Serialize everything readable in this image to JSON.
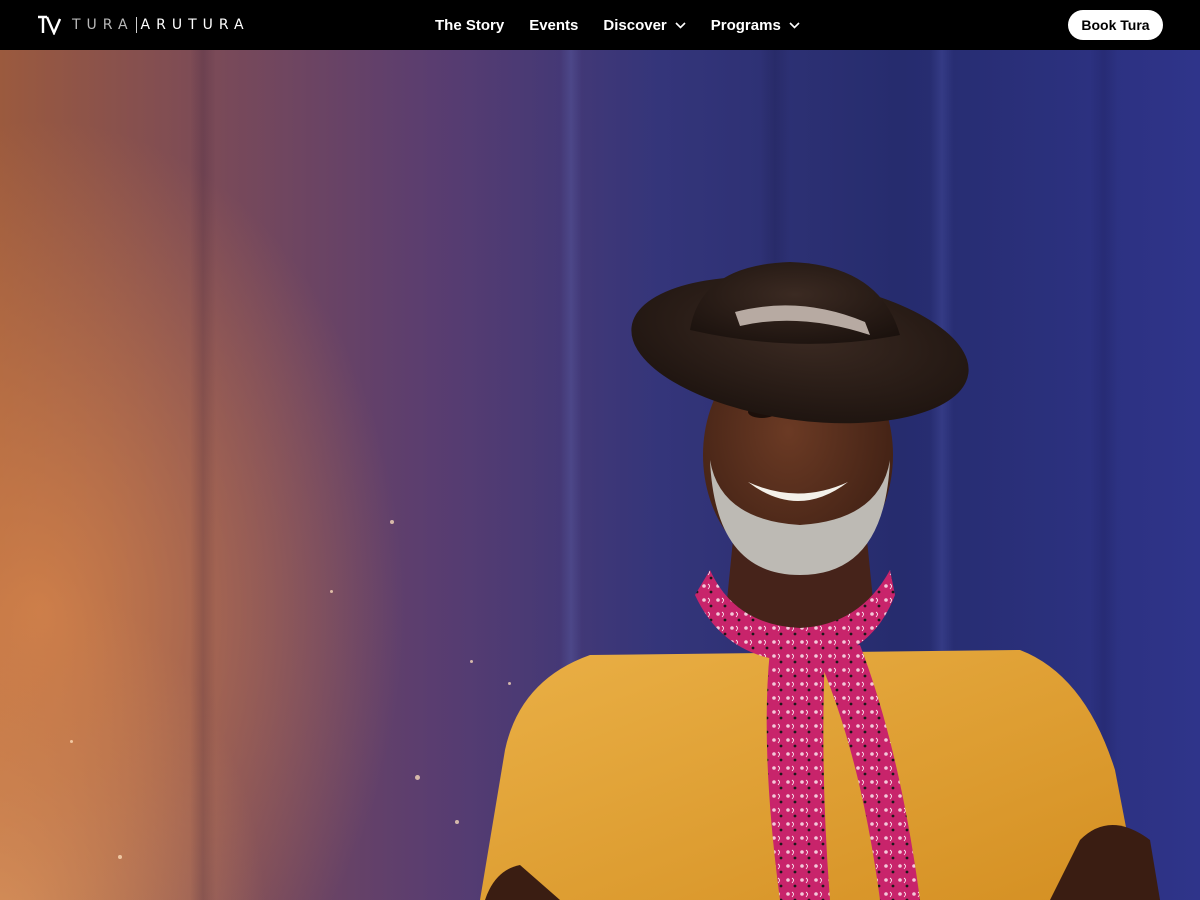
{
  "brand": {
    "name_primary": "TURA",
    "name_secondary": "ARUTURA",
    "logo_icon": "tura-logo-mark"
  },
  "nav": {
    "items": [
      {
        "label": "The Story",
        "has_dropdown": false
      },
      {
        "label": "Events",
        "has_dropdown": false
      },
      {
        "label": "Discover",
        "has_dropdown": true
      },
      {
        "label": "Programs",
        "has_dropdown": true
      }
    ]
  },
  "cta": {
    "label": "Book Tura"
  },
  "hero": {
    "image": "smiling-man-in-hat-and-red-bandana"
  },
  "colors": {
    "header_bg": "#000000",
    "cta_bg": "#ffffff",
    "shirt": "#e4a332",
    "bandana": "#c8246b",
    "hat": "#2b1d17"
  }
}
